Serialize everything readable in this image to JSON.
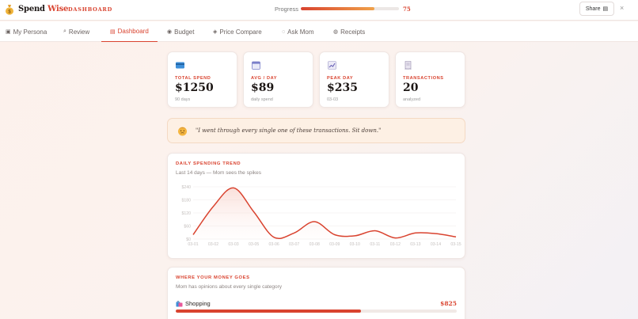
{
  "header": {
    "brand_part1": "Spend",
    "brand_part2": "Wise",
    "section": "DASHBOARD",
    "progress_label": "Progress",
    "progress_value": "75",
    "progress_fraction": 0.75,
    "share_label": "Share",
    "close_label": "×",
    "colors": {
      "accent": "#d9432f",
      "accent_light": "#f0a24a"
    }
  },
  "tabs": [
    {
      "label": "My Persona",
      "icon": "persona-icon",
      "glyph": "▣",
      "active": false
    },
    {
      "label": "Review",
      "icon": "magnifier-icon",
      "glyph": "⌕",
      "active": false
    },
    {
      "label": "Dashboard",
      "icon": "chart-icon",
      "glyph": "▤",
      "active": true
    },
    {
      "label": "Budget",
      "icon": "money-bag-icon",
      "glyph": "◉",
      "active": false
    },
    {
      "label": "Price Compare",
      "icon": "tag-icon",
      "glyph": "◈",
      "active": false
    },
    {
      "label": "Ask Mom",
      "icon": "speech-bubble-icon",
      "glyph": "◌",
      "active": false
    },
    {
      "label": "Receipts",
      "icon": "receipt-icon",
      "glyph": "◍",
      "active": false
    }
  ],
  "stats": [
    {
      "label": "TOTAL SPEND",
      "value": "$1250",
      "sub": "90 days",
      "icon": "credit-card-icon"
    },
    {
      "label": "AVG / DAY",
      "value": "$89",
      "sub": "daily spend",
      "icon": "calendar-icon"
    },
    {
      "label": "PEAK DAY",
      "value": "$235",
      "sub": "03-03",
      "icon": "trend-up-icon"
    },
    {
      "label": "TRANSACTIONS",
      "value": "20",
      "sub": "analyzed",
      "icon": "receipt-icon"
    }
  ],
  "quote": {
    "text": "\"I went through every single one of these transactions. Sit down.\"",
    "icon": "mom-emoji-icon"
  },
  "chart_data": {
    "type": "line",
    "title": "DAILY SPENDING TREND",
    "subtitle": "Last 14 days — Mom sees the spikes",
    "x": [
      "03-01",
      "03-02",
      "03-03",
      "03-05",
      "03-06",
      "03-07",
      "03-08",
      "03-09",
      "03-10",
      "03-11",
      "03-12",
      "03-13",
      "03-14",
      "03-15"
    ],
    "values": [
      20,
      150,
      235,
      125,
      8,
      28,
      80,
      20,
      15,
      38,
      5,
      28,
      25,
      10
    ],
    "yticks": [
      "$240",
      "$180",
      "$120",
      "$60",
      "$0"
    ],
    "ylim": [
      0,
      240
    ],
    "grid": true,
    "color": "#d9432f"
  },
  "categories": {
    "title": "WHERE YOUR MONEY GOES",
    "subtitle": "Mom has opinions about every single category",
    "items": [
      {
        "name": "Shopping",
        "amount": "$825",
        "fraction": 0.66,
        "icon": "shopping-bags-icon"
      }
    ]
  }
}
